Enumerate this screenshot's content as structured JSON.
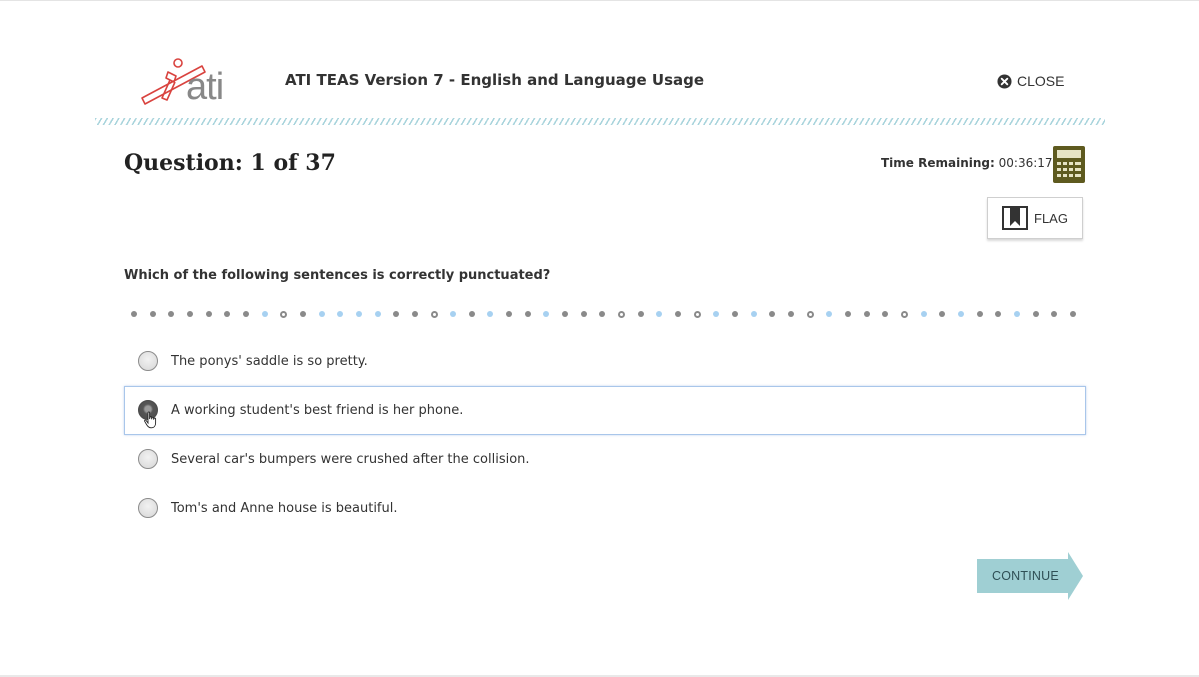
{
  "header": {
    "logo_text": "ati",
    "title": "ATI TEAS Version 7 - English and Language Usage",
    "close_label": "CLOSE",
    "close_icon": "close-circle-icon"
  },
  "question": {
    "title": "Question: 1 of 37",
    "text": "Which of the following sentences is correctly punctuated?"
  },
  "timer": {
    "label": "Time Remaining:",
    "value": "00:36:17"
  },
  "tools": {
    "calculator_icon": "calculator-icon",
    "flag_label": "FLAG",
    "flag_icon": "flag-bookmark-icon"
  },
  "progress": {
    "dots": [
      "answered",
      "answered",
      "answered",
      "answered",
      "answered",
      "answered",
      "answered",
      "unanswered",
      "ring",
      "answered",
      "unanswered",
      "unanswered",
      "unanswered",
      "unanswered",
      "answered",
      "answered",
      "ring",
      "unanswered",
      "answered",
      "unanswered",
      "answered",
      "answered",
      "unanswered",
      "answered",
      "answered",
      "answered",
      "ring",
      "answered",
      "unanswered",
      "answered",
      "ring",
      "unanswered",
      "answered",
      "unanswered",
      "answered",
      "answered",
      "ring",
      "unanswered",
      "answered",
      "answered",
      "answered",
      "ring",
      "unanswered",
      "answered",
      "unanswered",
      "answered",
      "answered",
      "unanswered",
      "answered",
      "answered",
      "answered"
    ]
  },
  "options": [
    {
      "text": "The ponys' saddle is so pretty.",
      "selected": false
    },
    {
      "text": "A working student's best friend is her phone.",
      "selected": true
    },
    {
      "text": "Several car's bumpers were crushed after the collision.",
      "selected": false
    },
    {
      "text": "Tom's and Anne house is beautiful.",
      "selected": false
    }
  ],
  "footer": {
    "continue_label": "CONTINUE"
  },
  "colors": {
    "hatch": "#a9d4dc",
    "logo_red": "#d9433f",
    "calculator": "#5e5a1f",
    "continue_fill": "#9fcfd3",
    "unanswered_dot": "#a7d1f1",
    "answered_dot": "#8a8a8a",
    "selected_border": "#a9c6ea"
  }
}
